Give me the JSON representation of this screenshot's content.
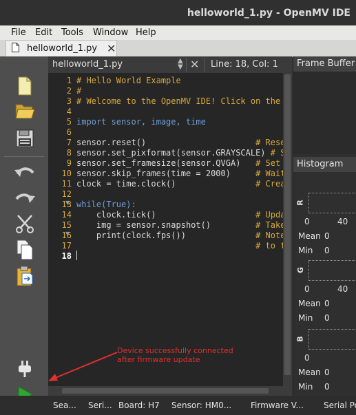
{
  "window": {
    "title": "helloworld_1.py - OpenMV IDE"
  },
  "menu": [
    "File",
    "Edit",
    "Tools",
    "Window",
    "Help"
  ],
  "file_tab": {
    "label": "helloworld_1.py",
    "close_glyph": "✕"
  },
  "editor": {
    "filename": "helloworld_1.py",
    "position": "Line: 18, Col: 1",
    "line_numbers": [
      "1",
      "2",
      "3",
      "4",
      "5",
      "6",
      "7",
      "8",
      "9",
      "10",
      "11",
      "12",
      "13",
      "14",
      "15",
      "16",
      "17",
      "18"
    ],
    "code_lines": [
      "# Hello World Example",
      "#",
      "# Welcome to the OpenMV IDE! Click on the",
      "",
      "import sensor, image, time",
      "",
      "sensor.reset()                      # Rese",
      "sensor.set_pixformat(sensor.GRAYSCALE) # S",
      "sensor.set_framesize(sensor.QVGA)   # Set",
      "sensor.skip_frames(time = 2000)     # Wait",
      "clock = time.clock()                # Crea",
      "",
      "while(True):",
      "    clock.tick()                    # Upda",
      "    img = sensor.snapshot()         # Take",
      "    print(clock.fps())              # Note",
      "                                    # to t",
      ""
    ]
  },
  "frame_buffer": {
    "title": "Frame Buffer"
  },
  "histogram": {
    "title": "Histogram",
    "channels": [
      {
        "letter": "R",
        "tick_start": "0",
        "tick_mid": "40",
        "mean_label": "Mean",
        "mean": "0",
        "min_label": "Min",
        "min": "0"
      },
      {
        "letter": "G",
        "tick_start": "0",
        "tick_mid": "40",
        "mean_label": "Mean",
        "mean": "0",
        "min_label": "Min",
        "min": "0"
      },
      {
        "letter": "B",
        "tick_start": "0",
        "tick_mid": "",
        "mean_label": "Mean",
        "mean": "0",
        "min_label": "Min",
        "min": "0"
      }
    ]
  },
  "annotation": {
    "line1": "Device successfully connected",
    "line2": "after firmware update",
    "color": "#e03030"
  },
  "statusbar": {
    "search": "Sea...",
    "serial": "Seri...",
    "board": "Board: H7",
    "sensor": "Sensor: HM0...",
    "firmware": "Firmware V...",
    "serial_port": "Serial Po"
  },
  "colors": {
    "comment": "#d8a93c",
    "keyword": "#6f9fd8",
    "string_num": "#d8a93c",
    "connect_green": "#2ea72e"
  }
}
